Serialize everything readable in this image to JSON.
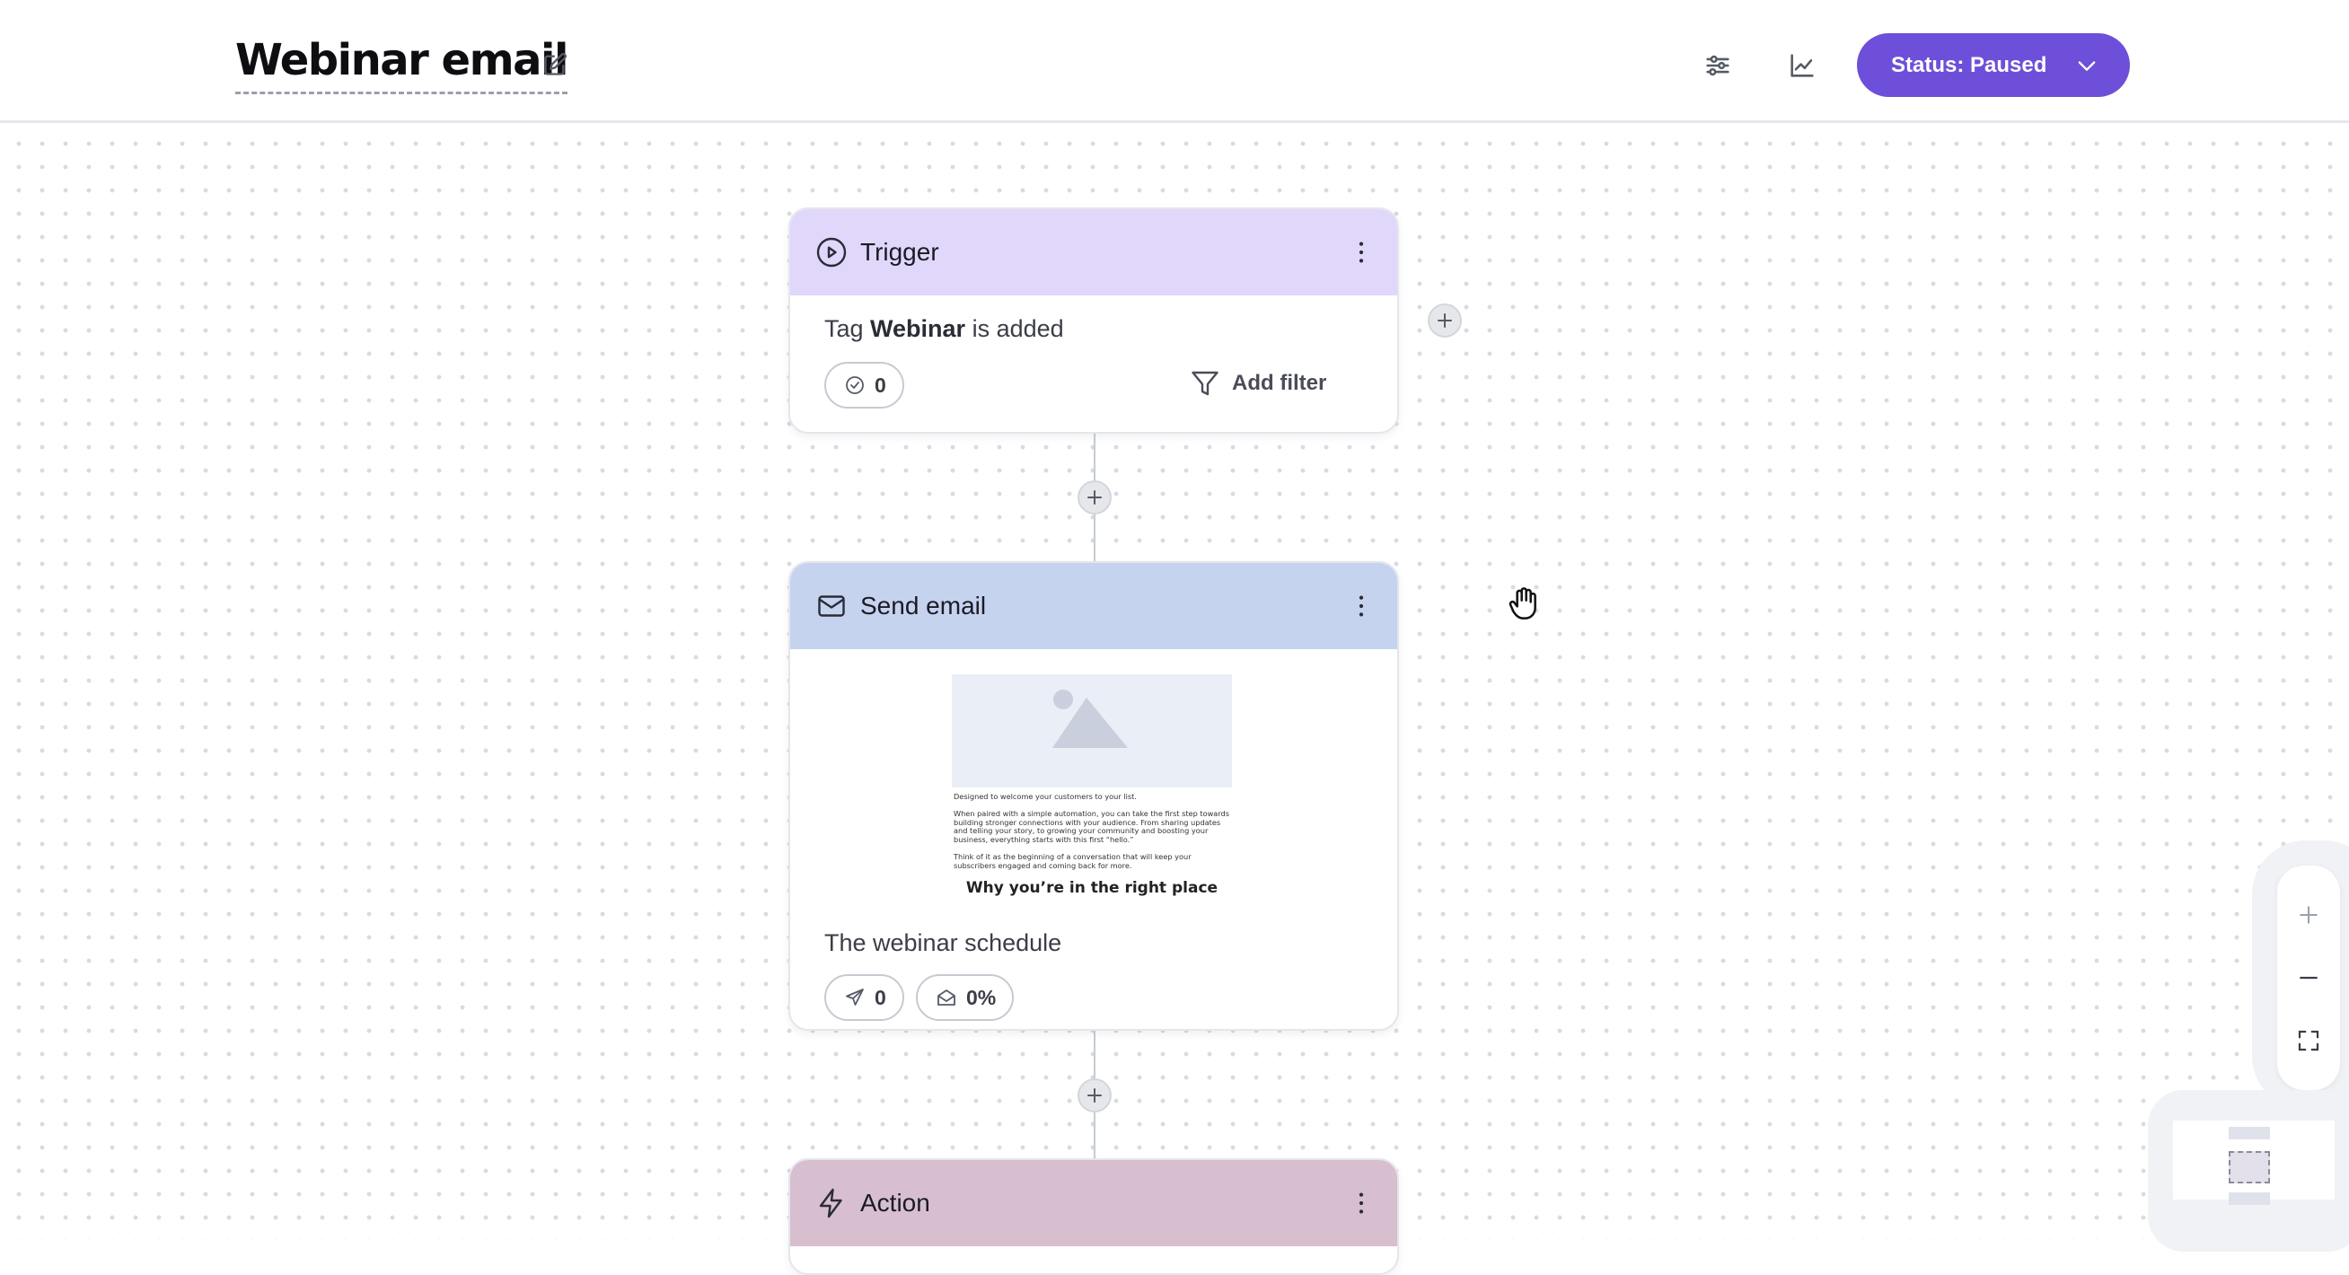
{
  "header": {
    "title": "Webinar email",
    "status_label": "Status: Paused"
  },
  "colors": {
    "accent": "#6e4fd9",
    "trigger_header": "#e0d7fb",
    "email_header": "#c6d3ef",
    "action_header": "#d7bfcf"
  },
  "nodes": {
    "trigger": {
      "title": "Trigger",
      "desc_prefix": "Tag ",
      "desc_tag": "Webinar",
      "desc_suffix": " is added",
      "count": "0",
      "add_filter_label": "Add filter"
    },
    "send_email": {
      "title": "Send email",
      "preview_line1": "Designed to welcome your customers to your list.",
      "preview_line2": "When paired with a simple automation, you can take the first step towards building stronger connections with your audience. From sharing updates and telling your story, to growing your community and boosting your business, everything starts with this first “hello.”",
      "preview_line3": "Think of it as the beginning of a conversation that will keep your subscribers engaged and coming back for more.",
      "preview_heading": "Why you’re in the right place",
      "subject": "The webinar schedule",
      "sent_count": "0",
      "open_rate": "0%"
    },
    "action": {
      "title": "Action"
    }
  },
  "icons": {
    "title_edit": "edit-icon",
    "settings": "sliders-icon",
    "analytics": "chart-icon",
    "status_dropdown": "chevron-down-icon",
    "trigger": "play-circle-icon",
    "email": "mail-icon",
    "action": "lightning-icon",
    "menu": "kebab-icon",
    "cursor": "hand-icon"
  }
}
